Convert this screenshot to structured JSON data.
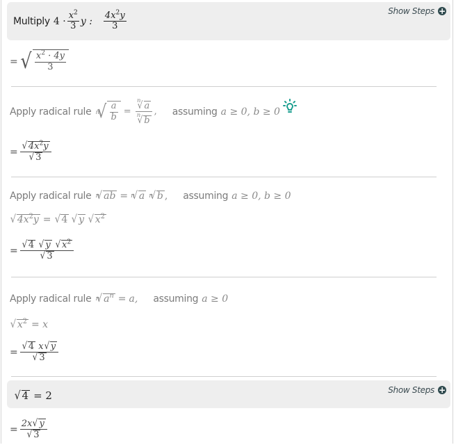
{
  "header_step": {
    "label": "Multiply",
    "expr_prefix": "4 ·",
    "frac_num": "x",
    "frac_num_exp": "2",
    "frac_den": "3",
    "after_frac": "y :",
    "result_num_a": "4x",
    "result_num_exp": "2",
    "result_num_b": "y",
    "result_den": "3",
    "show_steps": "Show Steps"
  },
  "line1": {
    "eq": "=",
    "num_a": "x",
    "num_exp": "2",
    "num_b": "· 4y",
    "den": "3"
  },
  "rule1": {
    "label": "Apply radical rule",
    "index": "n",
    "a": "a",
    "b": "b",
    "eq": "=",
    "comma": ",",
    "assuming": "assuming",
    "cond": "a ≥ 0, b ≥ 0",
    "hint_icon": "lightbulb-icon",
    "hint_color": "#1a9e8f",
    "result_eq": "=",
    "result_num": "4x",
    "result_num_exp": "2",
    "result_num_b": "y",
    "result_den": "3"
  },
  "rule2": {
    "label": "Apply radical rule",
    "index": "n",
    "ab": "ab",
    "a": "a",
    "b": "b",
    "eq": "=",
    "comma": ",",
    "assuming": "assuming",
    "cond": "a ≥ 0, b ≥ 0",
    "expand_lhs_a": "4x",
    "expand_lhs_exp": "2",
    "expand_lhs_b": "y",
    "expand_eq": "=",
    "expand_r1": "4",
    "expand_r2": "y",
    "expand_r3": "x",
    "expand_r3_exp": "2",
    "result_eq": "=",
    "result_den": "3"
  },
  "rule3": {
    "label": "Apply radical rule",
    "index": "n",
    "a": "a",
    "n": "n",
    "eq": "=",
    "rhs": "a,",
    "assuming": "assuming",
    "cond": "a ≥ 0",
    "expand_lhs": "x",
    "expand_lhs_exp": "2",
    "expand_rhs": "= x",
    "result_eq": "=",
    "result_r1": "4",
    "result_x": "x",
    "result_r2": "y",
    "result_den": "3"
  },
  "sub_step": {
    "radicand": "4",
    "eq": "= 2",
    "show_steps": "Show Steps"
  },
  "final": {
    "eq": "=",
    "num_a": "2x",
    "num_rad": "y",
    "den": "3"
  }
}
